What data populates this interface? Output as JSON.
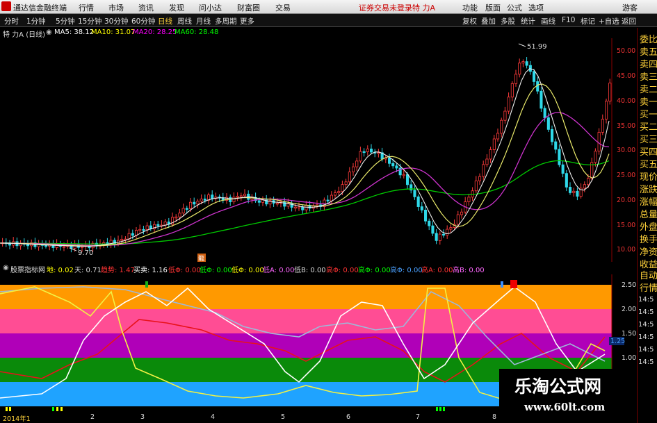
{
  "menubar": {
    "app_name": "通达信金融终端",
    "items": [
      "行情",
      "市场",
      "资讯",
      "发现",
      "问小达",
      "财富圈",
      "交易"
    ],
    "login_notice": "证券交易未登录",
    "stock_name": "特 力A",
    "right_items": [
      "功能",
      "版面",
      "公式",
      "选项"
    ],
    "guest": "游客"
  },
  "toolbar": {
    "periods": [
      "分时",
      "1分钟",
      "5分钟",
      "15分钟",
      "30分钟",
      "60分钟",
      "日线",
      "周线",
      "月线",
      "多周期",
      "更多"
    ],
    "active_period": "日线",
    "right_items": [
      "复权",
      "叠加",
      "多股",
      "统计",
      "画线",
      "F10",
      "标记",
      "+自选",
      "返回"
    ]
  },
  "main_legend": {
    "title": "特 力A (日线)",
    "ma5": "MA5: 38.12",
    "ma10": "MA10: 31.07",
    "ma20": "MA20: 28.25",
    "ma60": "MA60: 28.48",
    "colors": {
      "ma5": "#ffffff",
      "ma10": "#ffff00",
      "ma20": "#ff00ff",
      "ma60": "#00ff00"
    }
  },
  "price_axis": [
    "50.00",
    "45.00",
    "40.00",
    "35.00",
    "30.00",
    "25.00",
    "20.00",
    "15.00",
    "10.00"
  ],
  "price_high_label": "51.99",
  "price_low_label": "9.70",
  "event_marker": "龍",
  "indicator_legend": {
    "name": "股票指标网",
    "items": [
      {
        "label": "地: 0.02",
        "color": "#ffff00"
      },
      {
        "label": "天: 0.71",
        "color": "#dddddd"
      },
      {
        "label": "趋势: 1.47",
        "color": "#ff3333"
      },
      {
        "label": "买卖: 1.16",
        "color": "#ffffff"
      },
      {
        "label": "低Φ: 0.00",
        "color": "#ff3333"
      },
      {
        "label": "低Φ: 0.00",
        "color": "#00ff00"
      },
      {
        "label": "低Φ: 0.00",
        "color": "#ffff00"
      },
      {
        "label": "低A: 0.00",
        "color": "#ff66ff"
      },
      {
        "label": "低B: 0.00",
        "color": "#dddddd"
      },
      {
        "label": "高Φ: 0.00",
        "color": "#ff3333"
      },
      {
        "label": "高Φ: 0.00",
        "color": "#00ff00"
      },
      {
        "label": "高Φ: 0.00",
        "color": "#4aa0ff"
      },
      {
        "label": "高A: 0.00",
        "color": "#ff3333"
      },
      {
        "label": "高B: 0.00",
        "color": "#ff66ff"
      }
    ]
  },
  "indicator_axis": [
    "2.50",
    "2.00",
    "1.50",
    "1.00"
  ],
  "indicator_value_tag": "1.25",
  "side_panel": [
    "委比",
    "卖五",
    "卖四",
    "卖三",
    "卖二",
    "卖一",
    "买一",
    "买二",
    "买三",
    "买四",
    "买五",
    "现价",
    "涨跌",
    "涨幅",
    "总量",
    "外盘",
    "换手",
    "净资",
    "收益"
  ],
  "side_panel_bottom": [
    "自动",
    "行情"
  ],
  "side_times": [
    "14:5",
    "14:5",
    "14:5",
    "14:5",
    "14:5",
    "14:5"
  ],
  "date_labels": [
    "2014年1",
    "2",
    "3",
    "4",
    "5",
    "6",
    "7",
    "8"
  ],
  "watermark": {
    "title": "乐淘公式网",
    "url": "www.60lt.com"
  }
}
